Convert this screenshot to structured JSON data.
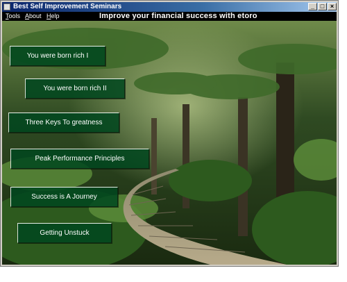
{
  "window": {
    "title": "Best Self Improvement Seminars",
    "controls": {
      "minimize": "_",
      "maximize": "□",
      "close": "×"
    }
  },
  "menubar": {
    "items": [
      {
        "label_first": "T",
        "label_rest": "ools"
      },
      {
        "label_first": "A",
        "label_rest": "bout"
      },
      {
        "label_first": "H",
        "label_rest": "elp"
      }
    ],
    "banner": "Improve your financial success with etoro"
  },
  "nav": {
    "buttons": [
      "You were born rich I",
      "You were born rich II",
      "Three Keys To greatness",
      "Peak Performance Principles",
      "Success is A Journey",
      "Getting Unstuck"
    ]
  },
  "colors": {
    "titlebar": "#0a246a",
    "menubar": "#000000",
    "button": "#00461e"
  }
}
